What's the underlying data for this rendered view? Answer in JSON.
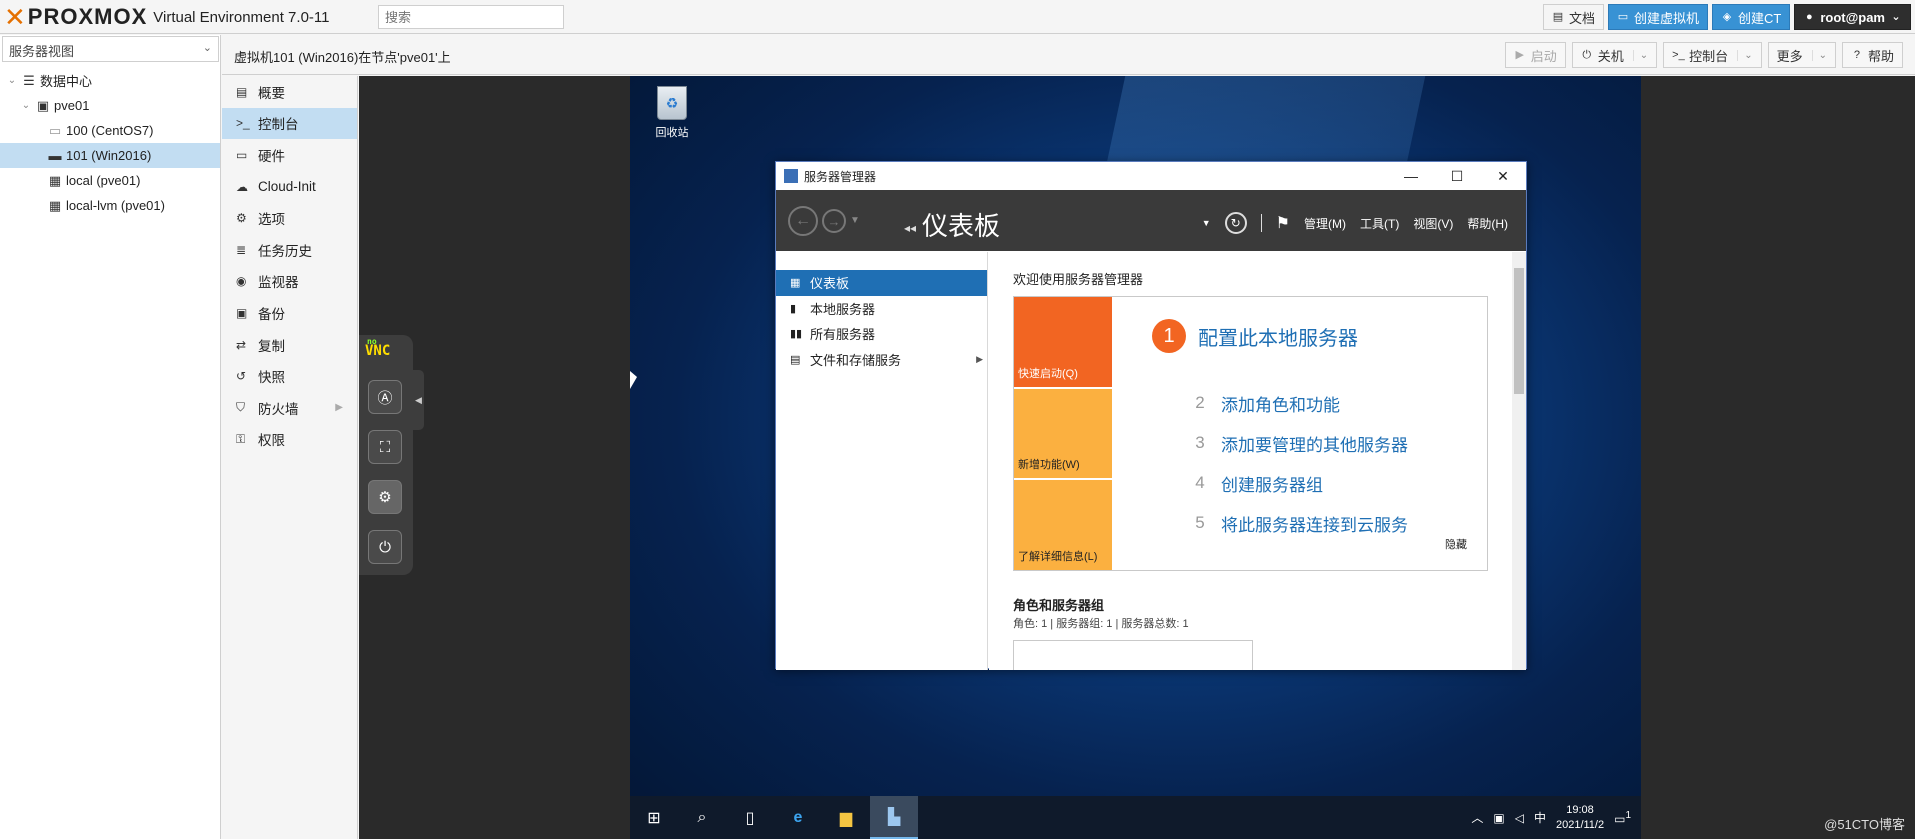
{
  "topbar": {
    "logo_text": "PROXMOX",
    "version": "Virtual Environment 7.0-11",
    "search_placeholder": "搜索",
    "buttons": {
      "docs": "文档",
      "create_vm": "创建虚拟机",
      "create_ct": "创建CT",
      "user": "root@pam"
    }
  },
  "left": {
    "view_selector": "服务器视图",
    "tree": [
      {
        "label": "数据中心",
        "icon": "datacenter-icon"
      },
      {
        "label": "pve01",
        "icon": "node-icon"
      },
      {
        "label": "100 (CentOS7)",
        "icon": "vm-stopped-icon"
      },
      {
        "label": "101 (Win2016)",
        "icon": "vm-running-icon"
      },
      {
        "label": "local (pve01)",
        "icon": "storage-icon"
      },
      {
        "label": "local-lvm (pve01)",
        "icon": "storage-icon"
      }
    ]
  },
  "content": {
    "title": "虚拟机101 (Win2016)在节点'pve01'上",
    "buttons": {
      "start": "启动",
      "shutdown": "关机",
      "console": "控制台",
      "more": "更多",
      "help": "帮助"
    }
  },
  "vm_menu": [
    {
      "label": "概要",
      "icon": "book-icon"
    },
    {
      "label": "控制台",
      "icon": "terminal-icon"
    },
    {
      "label": "硬件",
      "icon": "monitor-icon"
    },
    {
      "label": "Cloud-Init",
      "icon": "cloud-icon"
    },
    {
      "label": "选项",
      "icon": "gear-icon"
    },
    {
      "label": "任务历史",
      "icon": "list-icon"
    },
    {
      "label": "监视器",
      "icon": "eye-icon"
    },
    {
      "label": "备份",
      "icon": "floppy-icon"
    },
    {
      "label": "复制",
      "icon": "retweet-icon"
    },
    {
      "label": "快照",
      "icon": "history-icon"
    },
    {
      "label": "防火墙",
      "icon": "shield-icon"
    },
    {
      "label": "权限",
      "icon": "unlock-icon"
    }
  ],
  "novnc": {
    "brand_no": "no",
    "brand_vnc": "VNC"
  },
  "desktop": {
    "recycle_bin": "回收站",
    "server_manager": {
      "window_title": "服务器管理器",
      "breadcrumb": "仪表板",
      "menus": [
        "管理(M)",
        "工具(T)",
        "视图(V)",
        "帮助(H)"
      ],
      "nav": [
        "仪表板",
        "本地服务器",
        "所有服务器",
        "文件和存储服务"
      ],
      "welcome": "欢迎使用服务器管理器",
      "tiles": [
        "快速启动(Q)",
        "新增功能(W)",
        "了解详细信息(L)"
      ],
      "step1_num": "1",
      "step1": "配置此本地服务器",
      "steps": [
        {
          "n": "2",
          "label": "添加角色和功能"
        },
        {
          "n": "3",
          "label": "添加要管理的其他服务器"
        },
        {
          "n": "4",
          "label": "创建服务器组"
        },
        {
          "n": "5",
          "label": "将此服务器连接到云服务"
        }
      ],
      "hide": "隐藏",
      "roles_title": "角色和服务器组",
      "roles_sub": "角色: 1 | 服务器组: 1 | 服务器总数: 1"
    },
    "taskbar": {
      "ime": "中",
      "time": "19:08",
      "date": "2021/11/2",
      "notif_count": "1"
    }
  },
  "watermark": "@51CTO博客"
}
